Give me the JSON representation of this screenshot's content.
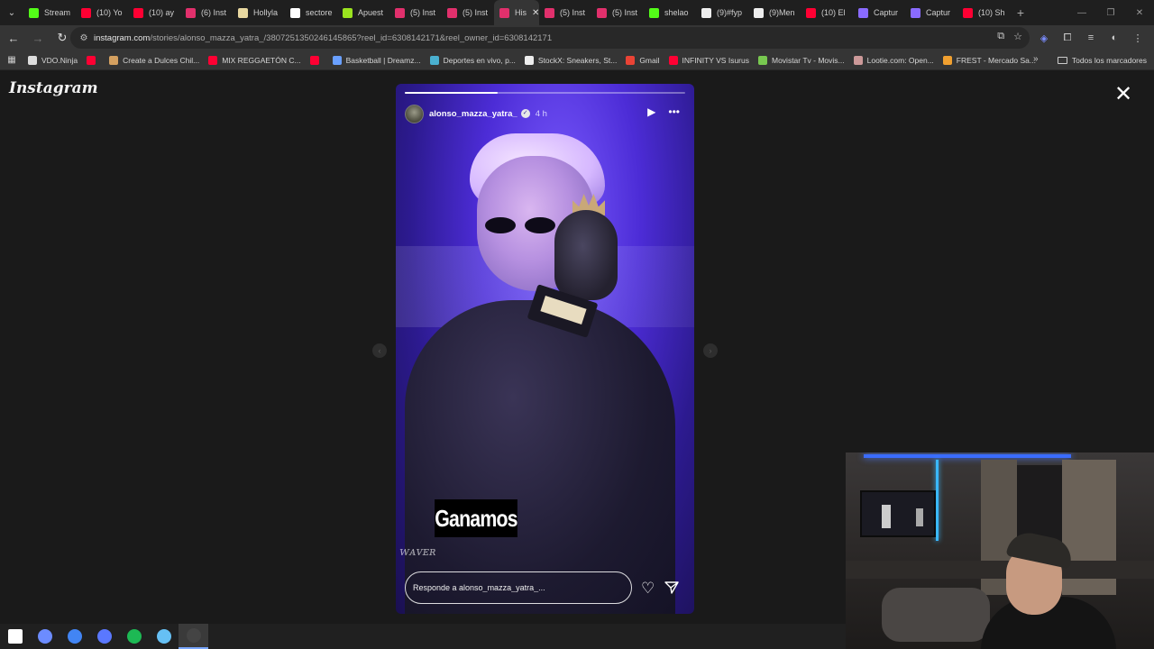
{
  "browser": {
    "tabs": [
      {
        "label": "Stream",
        "icon": "kick-icon",
        "color": "#53fc18"
      },
      {
        "label": "(10) Yo",
        "icon": "youtube-icon",
        "color": "#ff0033"
      },
      {
        "label": "(10) ay",
        "icon": "youtube-icon",
        "color": "#ff0033"
      },
      {
        "label": "(6) Inst",
        "icon": "instagram-icon",
        "color": "#e1306c"
      },
      {
        "label": "Hollyla",
        "icon": "web-icon",
        "color": "#e8d8a0"
      },
      {
        "label": "sectore",
        "icon": "google-icon",
        "color": "#ffffff"
      },
      {
        "label": "Apuest",
        "icon": "web-icon",
        "color": "#9be31f"
      },
      {
        "label": "(5) Inst",
        "icon": "instagram-icon",
        "color": "#e1306c"
      },
      {
        "label": "(5) Inst",
        "icon": "instagram-icon",
        "color": "#e1306c"
      },
      {
        "label": "His",
        "icon": "instagram-icon",
        "color": "#e1306c",
        "active": true
      },
      {
        "label": "(5) Inst",
        "icon": "instagram-icon",
        "color": "#e1306c"
      },
      {
        "label": "(5) Inst",
        "icon": "instagram-icon",
        "color": "#e1306c"
      },
      {
        "label": "shelao",
        "icon": "kick-icon",
        "color": "#53fc18"
      },
      {
        "label": "(9)#fyp",
        "icon": "tiktok-icon",
        "color": "#eeeeee"
      },
      {
        "label": "(9)Men",
        "icon": "tiktok-icon",
        "color": "#eeeeee"
      },
      {
        "label": "(10) El",
        "icon": "youtube-icon",
        "color": "#ff0033"
      },
      {
        "label": "Captur",
        "icon": "web-icon",
        "color": "#8a6bff"
      },
      {
        "label": "Captur",
        "icon": "web-icon",
        "color": "#8a6bff"
      },
      {
        "label": "(10) Sh",
        "icon": "youtube-icon",
        "color": "#ff0033"
      }
    ],
    "new_tab_label": "+",
    "url_domain": "instagram.com",
    "url_path": "/stories/alonso_mazza_yatra_/3807251350246145865?reel_id=6308142171&reel_owner_id=6308142171",
    "bookmarks": [
      {
        "label": "VDO.Ninja",
        "color": "#dddddd"
      },
      {
        "label": "",
        "color": "#ff0033"
      },
      {
        "label": "Create a Dulces Chil...",
        "color": "#d4a060"
      },
      {
        "label": "MIX REGGAETÓN C...",
        "color": "#ff0033"
      },
      {
        "label": "",
        "color": "#ff0033"
      },
      {
        "label": "Basketball | Dreamz...",
        "color": "#6aa0ff"
      },
      {
        "label": "Deportes en vivo, p...",
        "color": "#4ab0d0"
      },
      {
        "label": "StockX: Sneakers, St...",
        "color": "#eeeeee"
      },
      {
        "label": "Gmail",
        "color": "#ea4335"
      },
      {
        "label": "INFINITY VS Isurus",
        "color": "#ff0033"
      },
      {
        "label": "Movistar Tv - Movis...",
        "color": "#78c850"
      },
      {
        "label": "Lootie.com: Open...",
        "color": "#cc9999"
      },
      {
        "label": "FREST - Mercado Sa...",
        "color": "#f0a030"
      }
    ],
    "bookmarks_overflow": "»",
    "all_bookmarks_label": "Todos los marcadores"
  },
  "page": {
    "logo": "Instagram",
    "close_symbol": "✕",
    "story": {
      "progress_fraction": 0.33,
      "username": "alonso_mazza_yatra_",
      "verified": true,
      "time": "4 h",
      "caption": "Ganamos",
      "reply_placeholder": "Responde a alonso_mazza_yatra_..."
    }
  },
  "taskbar": {
    "icons": [
      {
        "name": "windows-start-icon",
        "color": "#ffffff"
      },
      {
        "name": "copilot-icon",
        "color": "#6c8cff"
      },
      {
        "name": "chrome-icon",
        "color": "#4285f4"
      },
      {
        "name": "chrome-profile-icon",
        "color": "#5a78ff"
      },
      {
        "name": "spotify-icon",
        "color": "#1db954"
      },
      {
        "name": "steam-icon",
        "color": "#66c0f4"
      },
      {
        "name": "obs-icon",
        "color": "#444444"
      }
    ]
  }
}
